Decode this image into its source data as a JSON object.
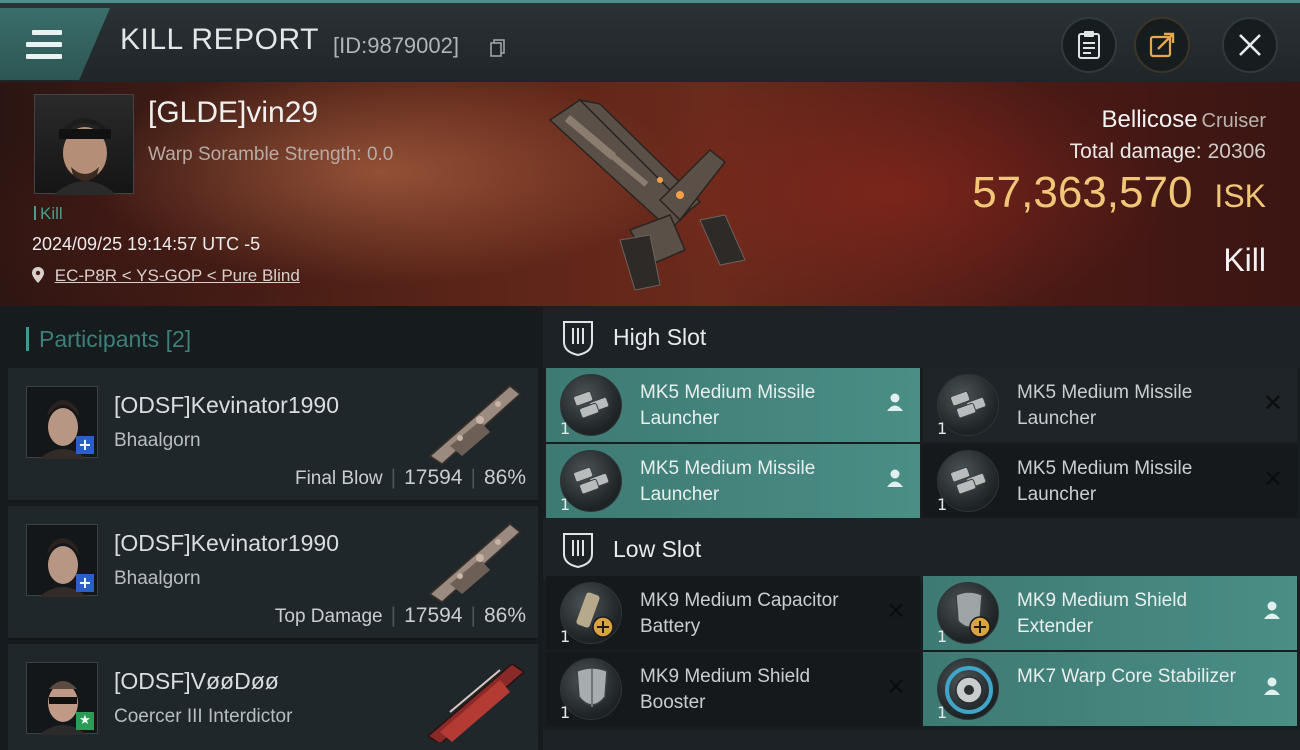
{
  "header": {
    "title": "KILL REPORT",
    "report_id": "[ID:9879002]"
  },
  "victim": {
    "name": "[GLDE]vin29",
    "scramble": "Warp Soramble Strength: 0.0",
    "kill_count": "Kill",
    "timestamp": "2024/09/25 19:14:57 UTC -5",
    "location": "EC-P8R < YS-GOP < Pure Blind",
    "ship_name": "Bellicose",
    "ship_class": "Cruiser",
    "total_damage_label": "Total damage:",
    "total_damage": "20306",
    "isk_value": "57,363,570",
    "isk_unit": "ISK",
    "result": "Kill"
  },
  "participants": {
    "title": "Participants",
    "count": "[2]",
    "items": [
      {
        "name": "[ODSF]Kevinator1990",
        "ship": "Bhaalgorn",
        "role": "Final Blow",
        "damage": "17594",
        "percent": "86%",
        "badge": "+"
      },
      {
        "name": "[ODSF]Kevinator1990",
        "ship": "Bhaalgorn",
        "role": "Top Damage",
        "damage": "17594",
        "percent": "86%",
        "badge": "+"
      },
      {
        "name": "[ODSF]VøøDøø",
        "ship": "Coercer III Interdictor",
        "badge": "★"
      }
    ]
  },
  "fittings": {
    "high_slot_title": "High Slot",
    "low_slot_title": "Low Slot",
    "high": [
      {
        "name": "MK5 Medium Missile Launcher",
        "qty": "1",
        "state": "dropped"
      },
      {
        "name": "MK5 Medium Missile Launcher",
        "qty": "1",
        "state": "destroyed"
      },
      {
        "name": "MK5 Medium Missile Launcher",
        "qty": "1",
        "state": "dropped"
      },
      {
        "name": "MK5 Medium Missile Launcher",
        "qty": "1",
        "state": "destroyed"
      }
    ],
    "low": [
      {
        "name": "MK9 Medium Capacitor Battery",
        "qty": "1",
        "state": "destroyed"
      },
      {
        "name": "MK9 Medium Shield Extender",
        "qty": "1",
        "state": "dropped"
      },
      {
        "name": "MK9 Medium Shield Booster",
        "qty": "1",
        "state": "destroyed"
      },
      {
        "name": "MK7 Warp Core Stabilizer",
        "qty": "1",
        "state": "dropped"
      }
    ]
  },
  "colors": {
    "accent": "#4a8e86",
    "isk": "#f0c777",
    "banner": "#5a2418"
  },
  "icons": {
    "menu": "menu-icon",
    "copy": "copy-icon",
    "clipboard": "clipboard-icon",
    "share": "share-icon",
    "close": "close-icon",
    "location": "location-pin-icon",
    "slot": "slot-icon",
    "dropped": "person-icon",
    "destroyed": "x-icon"
  }
}
